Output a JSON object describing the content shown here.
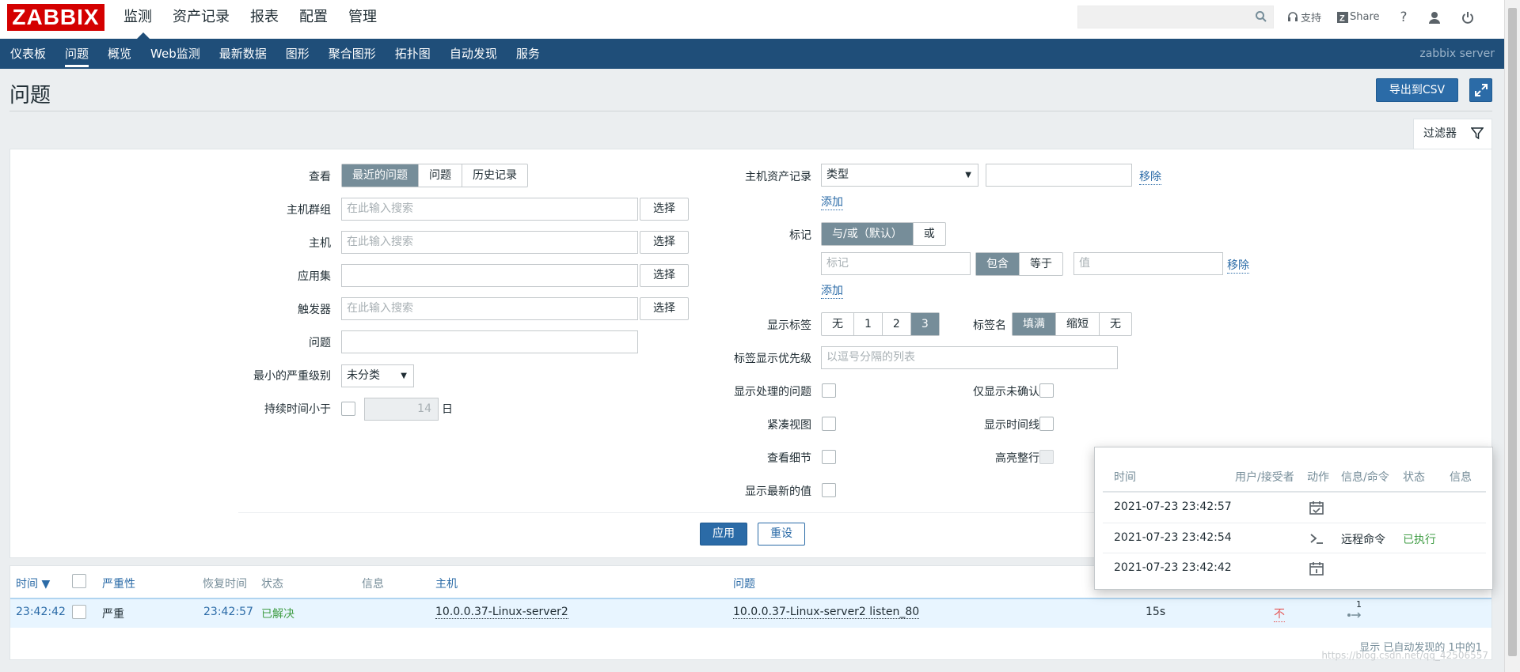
{
  "header": {
    "logo": "ZABBIX",
    "nav": [
      "监测",
      "资产记录",
      "报表",
      "配置",
      "管理"
    ],
    "support": "支持",
    "share": "Share",
    "help": "?"
  },
  "subnav": {
    "items": [
      "仪表板",
      "问题",
      "概览",
      "Web监测",
      "最新数据",
      "图形",
      "聚合图形",
      "拓扑图",
      "自动发现",
      "服务"
    ],
    "server": "zabbix server"
  },
  "page": {
    "title": "问题",
    "export_csv": "导出到CSV"
  },
  "filter": {
    "tab_label": "过滤器",
    "show_label": "查看",
    "show_options": [
      "最近的问题",
      "问题",
      "历史记录"
    ],
    "host_groups_label": "主机群组",
    "hosts_label": "主机",
    "application_label": "应用集",
    "triggers_label": "触发器",
    "problem_label": "问题",
    "min_severity_label": "最小的严重级别",
    "min_severity_value": "未分类",
    "age_label": "持续时间小于",
    "age_value": "14",
    "age_unit": "日",
    "search_placeholder": "在此输入搜索",
    "select_btn": "选择",
    "inventory_label": "主机资产记录",
    "inventory_type": "类型",
    "remove": "移除",
    "add": "添加",
    "tags_label": "标记",
    "tags_operator": [
      "与/或（默认）",
      "或"
    ],
    "tag_placeholder": "标记",
    "tag_ops": [
      "包含",
      "等于"
    ],
    "value_placeholder": "值",
    "show_tags_label": "显示标签",
    "show_tags_options": [
      "无",
      "1",
      "2",
      "3"
    ],
    "tag_name_label": "标签名",
    "tag_name_options": [
      "填满",
      "缩短",
      "无"
    ],
    "tag_priority_label": "标签显示优先级",
    "tag_priority_placeholder": "以逗号分隔的列表",
    "show_suppressed_label": "显示处理的问题",
    "unack_only_label": "仅显示未确认",
    "compact_label": "紧凑视图",
    "timeline_label": "显示时间线",
    "details_label": "查看细节",
    "highlight_label": "高亮整行",
    "latest_values_label": "显示最新的值",
    "apply": "应用",
    "reset": "重设"
  },
  "table": {
    "headers": {
      "time": "时间 ▼",
      "severity": "严重性",
      "recovery": "恢复时间",
      "status": "状态",
      "info": "信息",
      "host": "主机",
      "problem": "问题"
    },
    "row": {
      "time": "23:42:42",
      "severity": "严重",
      "recovery": "23:42:57",
      "status": "已解决",
      "host": "10.0.0.37-Linux-server2",
      "problem": "10.0.0.37-Linux-server2 listen_80",
      "duration": "15s",
      "ack": "不",
      "actions_count": "1"
    },
    "footer": "显示 已自动发现的 1中的1",
    "watermark": "https://blog.csdn.net/qq_42506557"
  },
  "popup": {
    "headers": [
      "时间",
      "用户/接受者",
      "动作",
      "信息/命令",
      "状态",
      "信息"
    ],
    "rows": [
      {
        "time": "2021-07-23 23:42:57",
        "icon": "calendar-check-icon",
        "command": "",
        "status": ""
      },
      {
        "time": "2021-07-23 23:42:54",
        "icon": "terminal-icon",
        "command": "远程命令",
        "status": "已执行"
      },
      {
        "time": "2021-07-23 23:42:42",
        "icon": "calendar-event-icon",
        "command": "",
        "status": ""
      }
    ]
  },
  "colors": {
    "brand": "#d40000",
    "nav_bg": "#1f4e79",
    "accent": "#2b6ba7",
    "ok": "#429e47",
    "problem": "#e45959"
  }
}
